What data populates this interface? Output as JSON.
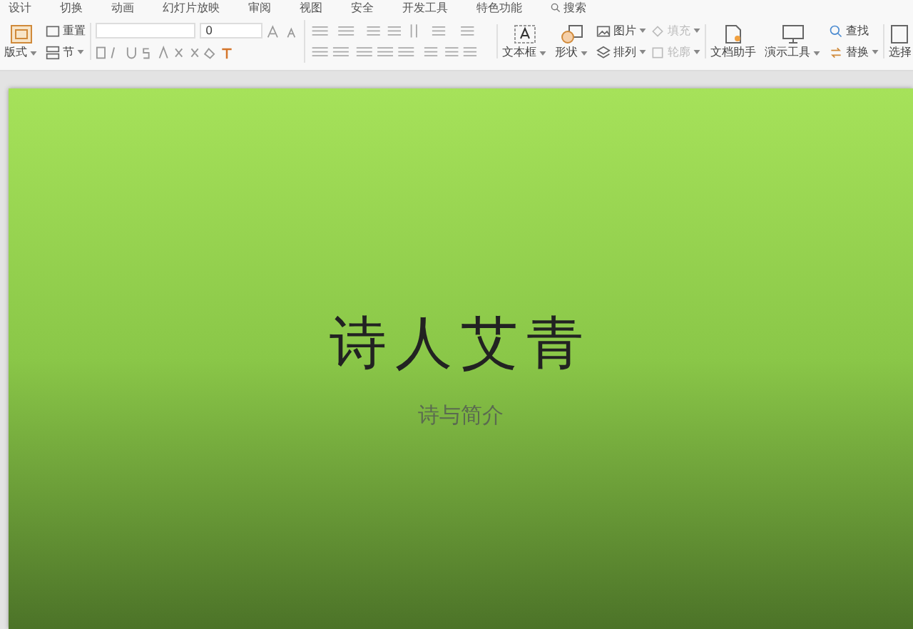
{
  "ribbon_tabs": [
    {
      "label": "设计"
    },
    {
      "label": "切换"
    },
    {
      "label": "动画"
    },
    {
      "label": "幻灯片放映"
    },
    {
      "label": "审阅"
    },
    {
      "label": "视图"
    },
    {
      "label": "安全"
    },
    {
      "label": "开发工具"
    },
    {
      "label": "特色功能"
    },
    {
      "label": "搜索",
      "kind": "search"
    }
  ],
  "toolbar": {
    "layout_button": "版式",
    "reset_button": "重置",
    "section_button": "节",
    "font_size": "0",
    "text_box": "文本框",
    "shape": "形状",
    "picture": {
      "label": "图片",
      "disabled": false
    },
    "fill": {
      "label": "填充",
      "disabled": true
    },
    "arrange": {
      "label": "排列",
      "disabled": false
    },
    "outline": {
      "label": "轮廓",
      "disabled": true
    },
    "doc_helper": "文档助手",
    "present_tools": "演示工具",
    "find": "查找",
    "replace": "替换",
    "select": "选择"
  },
  "slide": {
    "title": "诗人艾青",
    "subtitle": "诗与简介"
  }
}
